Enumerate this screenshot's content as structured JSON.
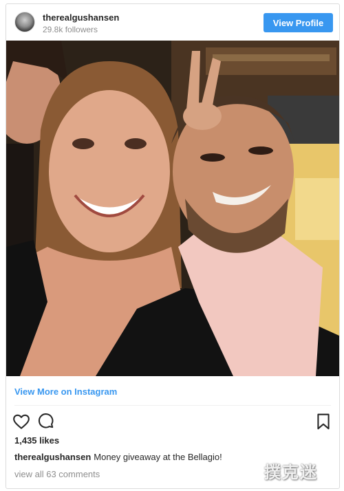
{
  "header": {
    "username": "therealgushansen",
    "followers": "29.8k followers",
    "view_profile_label": "View Profile"
  },
  "post": {
    "view_more_label": "View More on Instagram",
    "likes": "1,435 likes",
    "caption_user": "therealgushansen",
    "caption_text": "Money giveaway at the Bellagio!",
    "comments_link": "view all 63 comments"
  },
  "icons": {
    "like": "heart-icon",
    "comment": "comment-icon",
    "save": "bookmark-icon"
  },
  "watermark": {
    "text": "撲克迷"
  },
  "colors": {
    "accent": "#3897f0",
    "text": "#262626",
    "muted": "#8e8e8e"
  }
}
